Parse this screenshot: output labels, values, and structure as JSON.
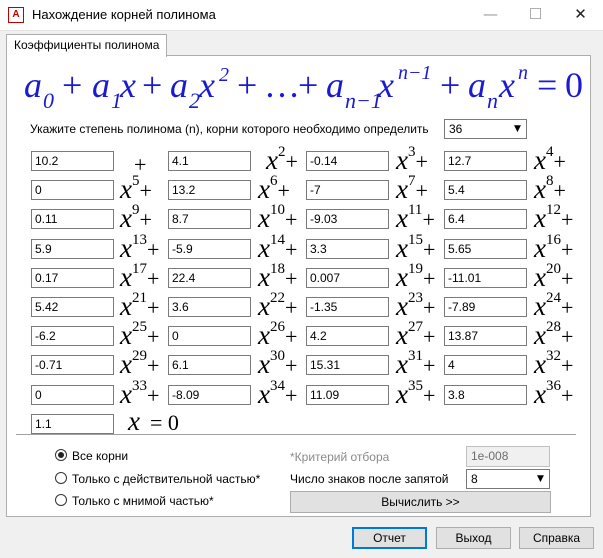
{
  "window": {
    "title": "Нахождение корней полинома",
    "icon": "polynomial-app-icon"
  },
  "window_controls": {
    "minimize": "—",
    "maximize": "☐",
    "close": "✕"
  },
  "tabs": [
    {
      "label": "Коэффициенты полинома",
      "active": true
    }
  ],
  "formula": {
    "a": "a",
    "x": "x",
    "plus": "+",
    "ellipsis": "…",
    "eq": "=",
    "zero": "0",
    "sub0": "0",
    "sub1": "1",
    "sub2": "2",
    "subn1": "n−1",
    "subn": "n",
    "sup2": "2",
    "supn1": "n−1",
    "supn": "n"
  },
  "degree": {
    "label": "Укажите степень полинома (n), корни которого необходимо определить",
    "value": "36"
  },
  "coefficients": [
    "10.2",
    "4.1",
    "-0.14",
    "12.7",
    "0",
    "13.2",
    "-7",
    "5.4",
    "0.11",
    "8.7",
    "-9.03",
    "6.4",
    "5.9",
    "-5.9",
    "3.3",
    "5.65",
    "0.17",
    "22.4",
    "0.007",
    "-11.01",
    "5.42",
    "3.6",
    "-1.35",
    "-7.89",
    "-6.2",
    "0",
    "4.2",
    "13.87",
    "-0.71",
    "6.1",
    "15.31",
    "4",
    "0",
    "-8.09",
    "11.09",
    "3.8",
    "1.1"
  ],
  "terms": {
    "x": "x",
    "plus": "+",
    "eq0": "= 0",
    "powers": [
      "",
      "2",
      "3",
      "4",
      "5",
      "6",
      "7",
      "8",
      "9",
      "10",
      "11",
      "12",
      "13",
      "14",
      "15",
      "16",
      "17",
      "18",
      "19",
      "20",
      "21",
      "22",
      "23",
      "24",
      "25",
      "26",
      "27",
      "28",
      "29",
      "30",
      "31",
      "32",
      "33",
      "34",
      "35",
      "36"
    ]
  },
  "root_filter": {
    "options": [
      {
        "label": "Все корни",
        "checked": true
      },
      {
        "label": "Только с действительной частью*",
        "checked": false
      },
      {
        "label": "Только с мнимой частью*",
        "checked": false
      }
    ],
    "criterion_label": "*Критерий отбора",
    "criterion_value": "1e-008"
  },
  "precision": {
    "label": "Число знаков после запятой",
    "value": "8"
  },
  "buttons": {
    "compute": "Вычислить >>",
    "report": "Отчет",
    "exit": "Выход",
    "help": "Справка"
  },
  "colors": {
    "formula": "#1a1ad2",
    "accent": "#0078d7"
  }
}
